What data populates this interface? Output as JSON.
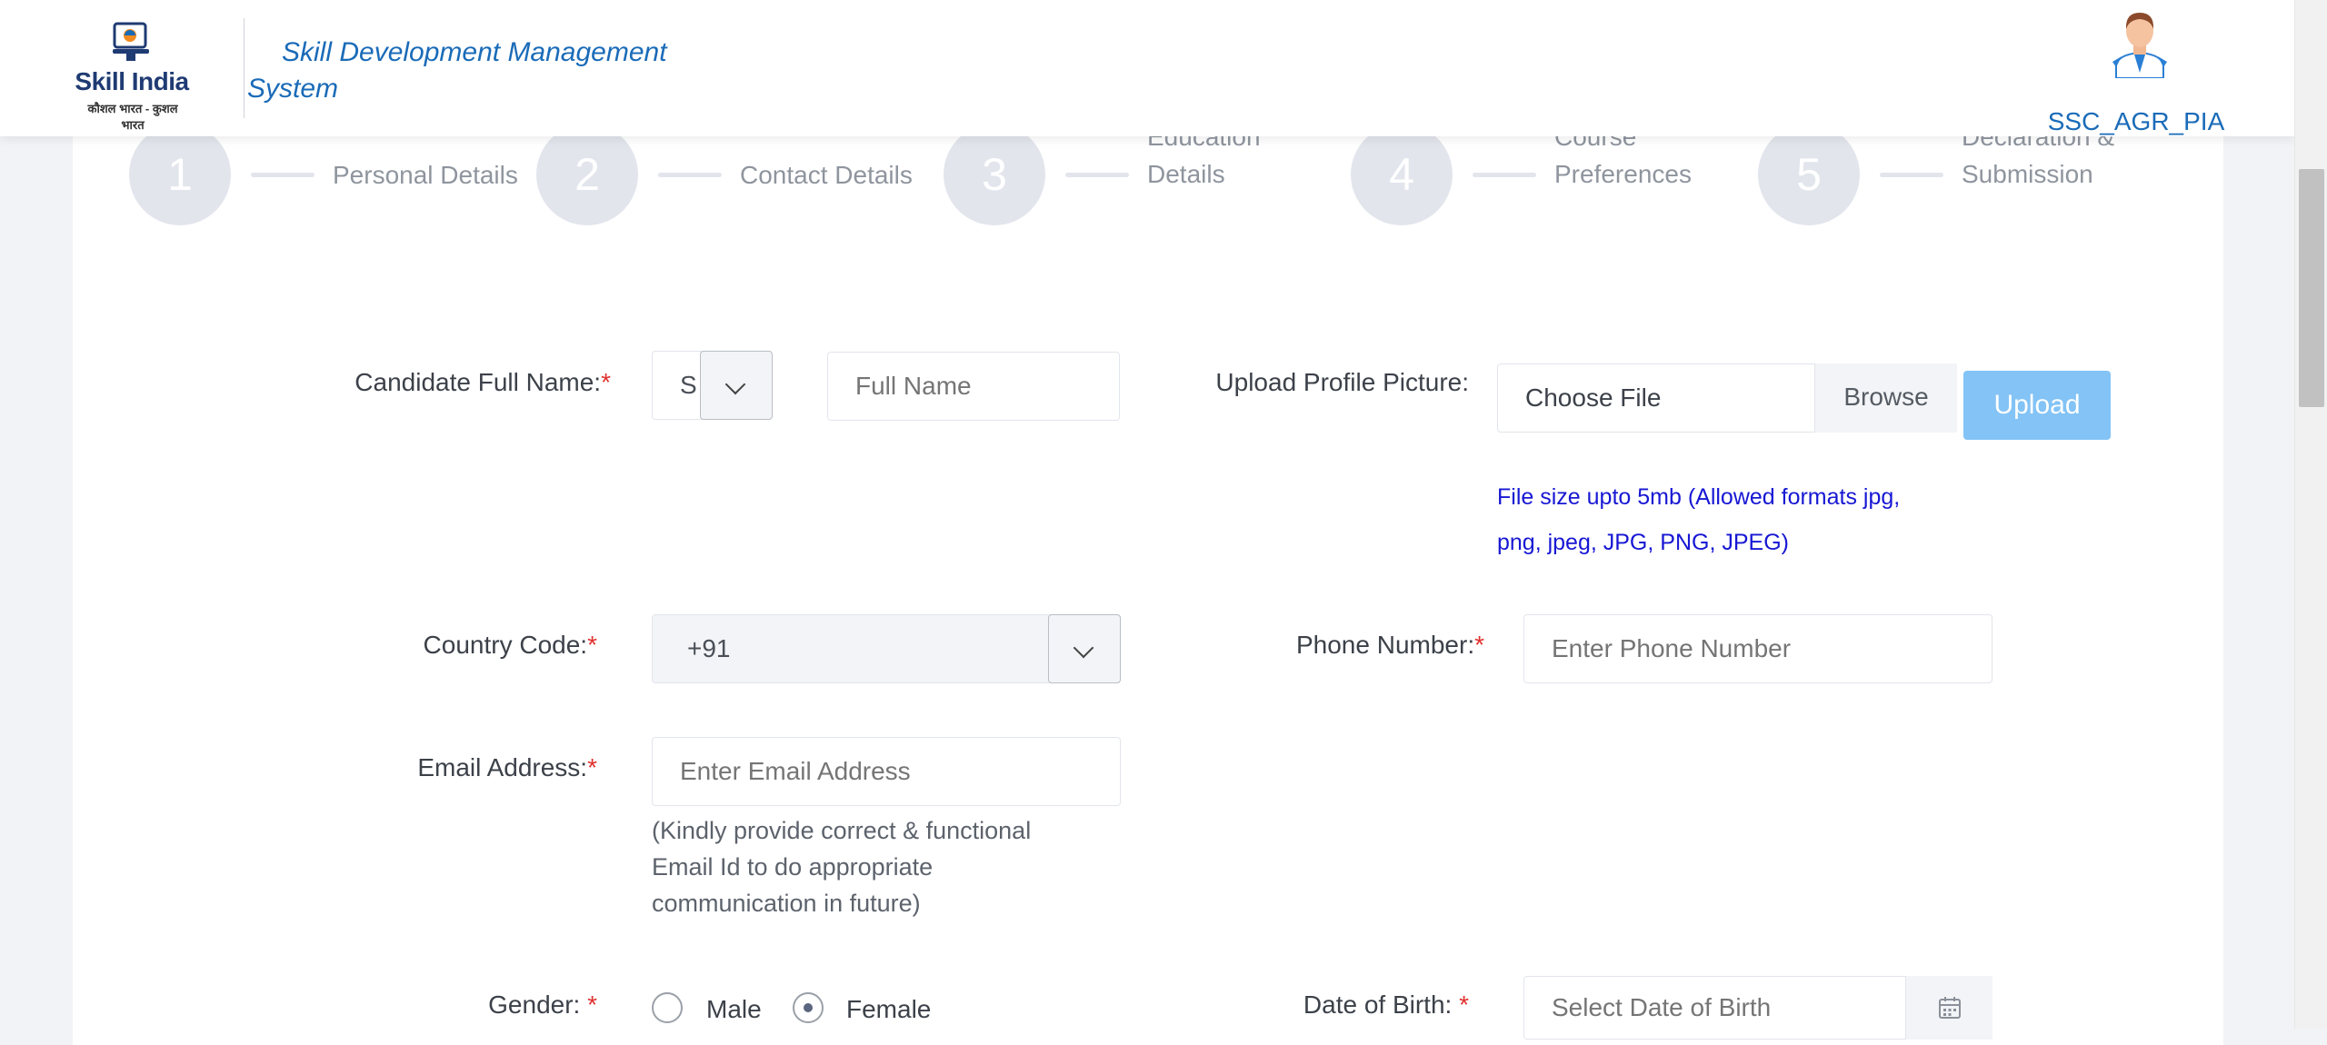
{
  "header": {
    "logo_name": "Skill India",
    "logo_tagline": "कौशल भारत - कुशल भारत",
    "app_title": "Skill Development Management System",
    "username": "SSC_AGR_PIA"
  },
  "steps": [
    {
      "number": "1",
      "label": "Personal Details"
    },
    {
      "number": "2",
      "label": "Contact Details"
    },
    {
      "number": "3",
      "label": "Education Details"
    },
    {
      "number": "4",
      "label": "Course Preferences"
    },
    {
      "number": "5",
      "label": "Declaration & Submission"
    }
  ],
  "form": {
    "full_name": {
      "label": "Candidate Full Name:",
      "required_mark": "*",
      "salutation_value": "S",
      "placeholder": "Full Name"
    },
    "profile_picture": {
      "label": "Upload Profile Picture:",
      "choose_text": "Choose File",
      "browse_label": "Browse",
      "upload_label": "Upload",
      "hint": "File size upto 5mb (Allowed formats jpg, png, jpeg, JPG, PNG, JPEG)"
    },
    "country_code": {
      "label": "Country Code:",
      "required_mark": "*",
      "value": "+91"
    },
    "phone": {
      "label": "Phone Number:",
      "required_mark": "*",
      "placeholder": "Enter Phone Number"
    },
    "email": {
      "label": "Email Address:",
      "required_mark": "*",
      "placeholder": "Enter Email Address",
      "hint": "(Kindly provide correct & functional Email Id to do appropriate communication in future)"
    },
    "gender": {
      "label": "Gender: ",
      "required_mark": "*",
      "options": [
        "Male",
        "Female"
      ],
      "selected": "Female"
    },
    "dob": {
      "label": "Date of Birth: ",
      "required_mark": "*",
      "placeholder": "Select Date of Birth"
    }
  },
  "colors": {
    "brand_blue": "#1a6bb8",
    "upload_button": "#83c3f6",
    "required": "#e0312e",
    "hint_blue": "#1717d4"
  },
  "icons": [
    "skill-india-emblem-icon",
    "user-avatar-icon",
    "chevron-down-icon",
    "calendar-icon"
  ]
}
